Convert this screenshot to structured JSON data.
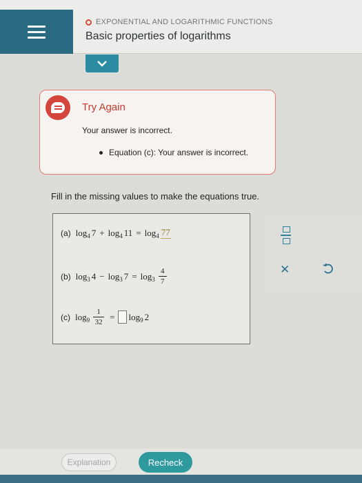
{
  "header": {
    "topic": "EXPONENTIAL AND LOGARITHMIC FUNCTIONS",
    "title": "Basic properties of logarithms"
  },
  "feedback": {
    "title": "Try Again",
    "message": "Your answer is incorrect.",
    "bullet": "Equation (c): Your answer is incorrect."
  },
  "instruction": "Fill in the missing values to make the equations true.",
  "equations": {
    "a": {
      "label": "(a)",
      "log": "log",
      "base": "4",
      "term1": "7",
      "plus": "+",
      "term2": "11",
      "eq": "=",
      "answer": "77"
    },
    "b": {
      "label": "(b)",
      "log": "log",
      "base": "3",
      "term1": "4",
      "minus": "−",
      "term2": "7",
      "eq": "=",
      "frac_num": "4",
      "frac_den": "7"
    },
    "c": {
      "label": "(c)",
      "log": "log",
      "base": "9",
      "frac_num": "1",
      "frac_den": "32",
      "eq": "=",
      "term": "2"
    }
  },
  "buttons": {
    "explanation": "Explanation",
    "recheck": "Recheck"
  },
  "colors": {
    "accent": "#2b8ba2",
    "error": "#d4453b",
    "recheck": "#2f9a9e"
  }
}
